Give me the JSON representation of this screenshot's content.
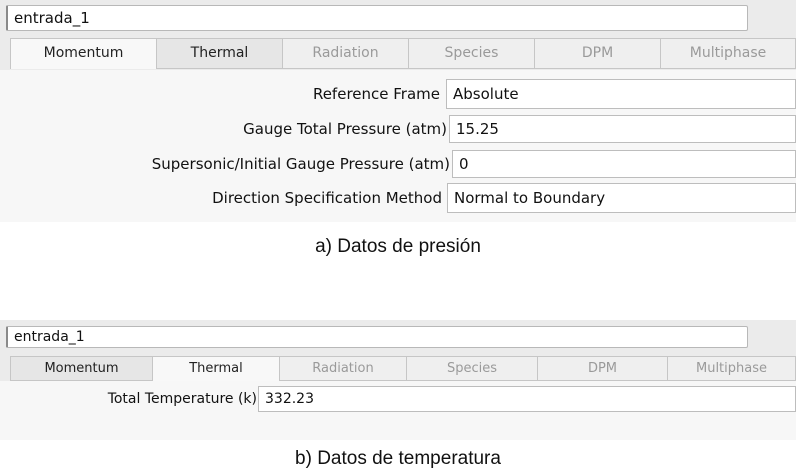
{
  "figure_a": {
    "zone_name": "entrada_1",
    "tabs": [
      {
        "label": "Momentum"
      },
      {
        "label": "Thermal"
      },
      {
        "label": "Radiation"
      },
      {
        "label": "Species"
      },
      {
        "label": "DPM"
      },
      {
        "label": "Multiphase"
      }
    ],
    "fields": [
      {
        "label": "Reference Frame",
        "value": "Absolute"
      },
      {
        "label": "Gauge Total Pressure (atm)",
        "value": "15.25"
      },
      {
        "label": "Supersonic/Initial Gauge Pressure (atm)",
        "value": "0"
      },
      {
        "label": "Direction Specification Method",
        "value": "Normal to Boundary"
      }
    ],
    "caption": "a) Datos de presión"
  },
  "figure_b": {
    "zone_name": "entrada_1",
    "tabs": [
      {
        "label": "Momentum"
      },
      {
        "label": "Thermal"
      },
      {
        "label": "Radiation"
      },
      {
        "label": "Species"
      },
      {
        "label": "DPM"
      },
      {
        "label": "Multiphase"
      }
    ],
    "fields": [
      {
        "label": "Total Temperature (k)",
        "value": "332.23"
      }
    ],
    "caption": "b) Datos de temperatura"
  }
}
